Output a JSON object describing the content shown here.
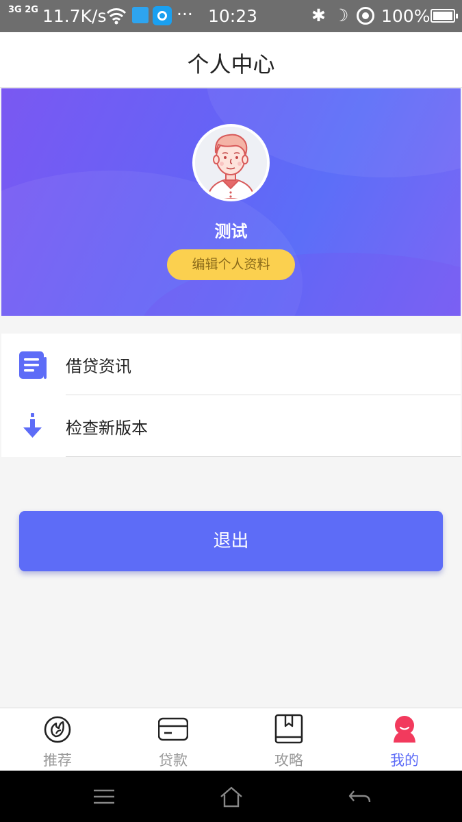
{
  "status_bar": {
    "network": "3G 2G",
    "speed": "11.7K/s",
    "dots": "···",
    "time": "10:23",
    "bluetooth": "✱",
    "moon": "☽",
    "battery": "100%"
  },
  "header": {
    "title": "个人中心"
  },
  "profile": {
    "name": "测试",
    "edit_label": "编辑个人资料"
  },
  "menu": {
    "items": [
      {
        "label": "借贷资讯",
        "icon": "document-icon"
      },
      {
        "label": "检查新版本",
        "icon": "download-arrow-icon"
      }
    ]
  },
  "logout": {
    "label": "退出"
  },
  "tabs": [
    {
      "label": "推荐",
      "icon": "flame-icon",
      "active": false
    },
    {
      "label": "贷款",
      "icon": "card-icon",
      "active": false
    },
    {
      "label": "攻略",
      "icon": "book-icon",
      "active": false
    },
    {
      "label": "我的",
      "icon": "profile-icon",
      "active": true
    }
  ],
  "colors": {
    "accent": "#5d6cf7",
    "active_tab_icon": "#f23a5d",
    "edit_button": "#fbd04f",
    "banner_start": "#7a58f2",
    "banner_end": "#5c6ef8"
  }
}
